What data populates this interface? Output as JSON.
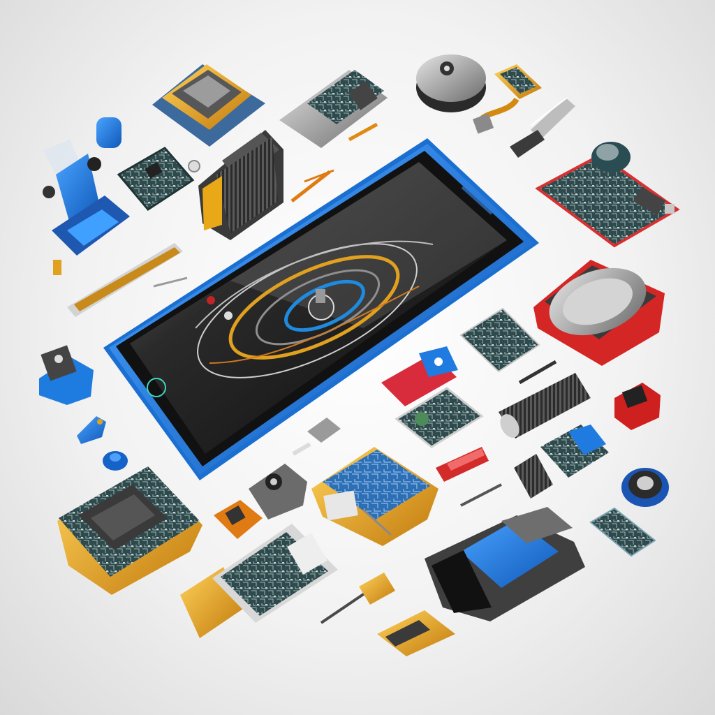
{
  "scene": {
    "subject": "disassembled-smartphone-components",
    "palette": {
      "background": "#eeeeee",
      "phone_frame": "#1f7fe0",
      "phone_screen": "#151515",
      "pcb_green": "#2e4a4a",
      "gold": "#e6a21a",
      "blue_part": "#1f6fd6",
      "red_part": "#d9262b",
      "metal": "#9a9a9a"
    }
  }
}
